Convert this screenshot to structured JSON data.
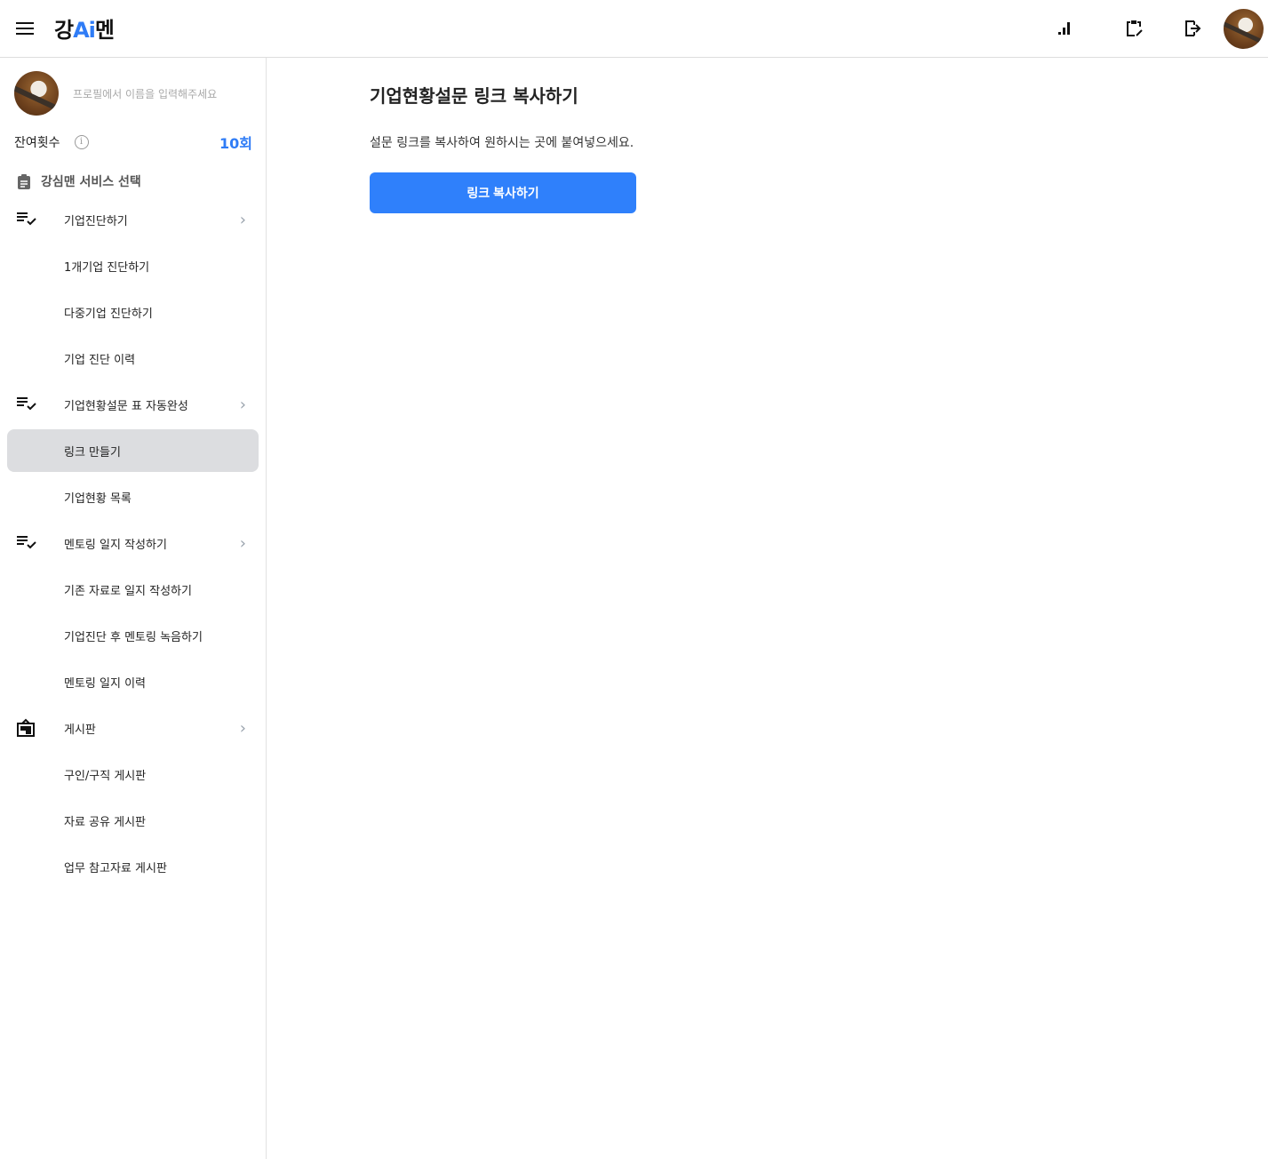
{
  "header": {
    "logo_parts": [
      "강",
      "Ai",
      "멘"
    ],
    "icons": [
      "stats-icon",
      "clipboard-edit-icon",
      "logout-icon",
      "avatar"
    ]
  },
  "sidebar": {
    "profile_name_placeholder": "프로필에서 이름을 입력해주세요",
    "remaining_label": "잔여횟수",
    "remaining_count": "10회",
    "service_title": "강심맨 서비스 선택",
    "items": [
      {
        "label": "기업진단하기",
        "group": true,
        "icon": "checklist-icon"
      },
      {
        "label": "1개기업 진단하기"
      },
      {
        "label": "다중기업 진단하기"
      },
      {
        "label": "기업 진단 이력"
      },
      {
        "label": "기업현황설문 표 자동완성",
        "group": true,
        "icon": "checklist-icon"
      },
      {
        "label": "링크 만들기",
        "selected": true
      },
      {
        "label": "기업현황 목록"
      },
      {
        "label": "멘토링 일지 작성하기",
        "group": true,
        "icon": "checklist-icon"
      },
      {
        "label": "기존 자료로 일지 작성하기"
      },
      {
        "label": "기업진단 후 멘토링 녹음하기"
      },
      {
        "label": "멘토링 일지 이력"
      },
      {
        "label": "게시판",
        "group": true,
        "icon": "board-icon"
      },
      {
        "label": "구인/구직 게시판"
      },
      {
        "label": "자료 공유 게시판"
      },
      {
        "label": "업무 참고자료 게시판"
      }
    ]
  },
  "main": {
    "title": "기업현황설문 링크 복사하기",
    "description": "설문 링크를 복사하여 원하시는 곳에 붙여넣으세요.",
    "button_label": "링크 복사하기"
  },
  "colors": {
    "accent": "#2f80fb",
    "selected_bg": "#dcdde0"
  }
}
